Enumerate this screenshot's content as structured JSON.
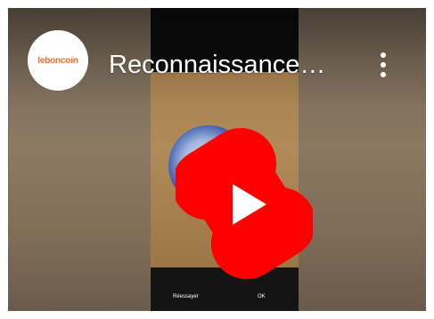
{
  "video": {
    "title": "Reconnaissance…",
    "channel_logo_text": "leboncoin"
  },
  "phone_screen": {
    "retry_label": "Réessayer",
    "ok_label": "OK"
  },
  "icons": {
    "menu": "more-vert-icon",
    "play": "youtube-shorts-play-icon"
  },
  "colors": {
    "shorts_red": "#ff0000",
    "brand_orange": "#f56b2a"
  }
}
